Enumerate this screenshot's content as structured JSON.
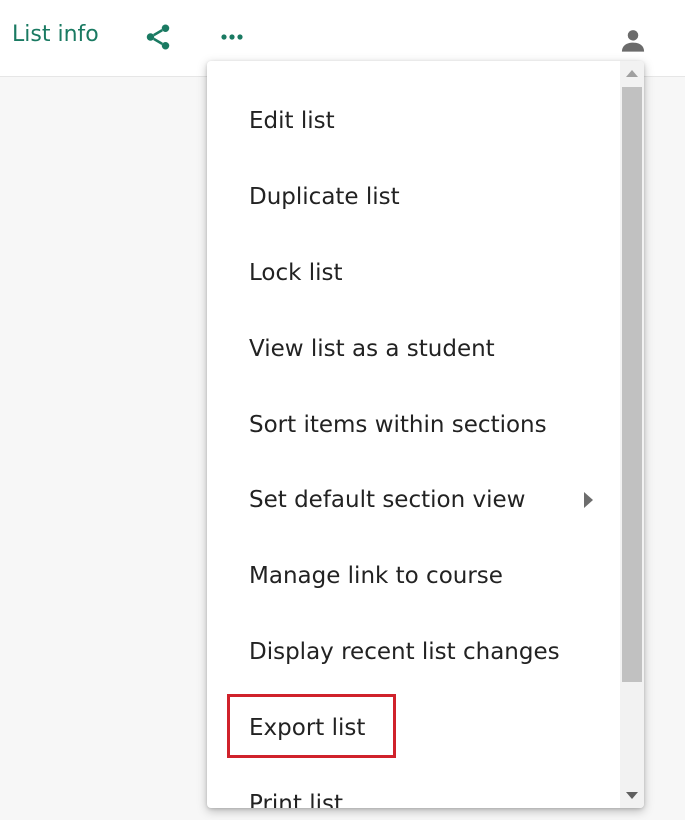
{
  "toolbar": {
    "list_info_label": "List info",
    "share_icon": "share-icon",
    "more_icon": "more-horizontal-icon",
    "user_icon": "user-icon",
    "accent_color": "#1a7a62"
  },
  "menu": {
    "items": [
      {
        "label": "Edit list"
      },
      {
        "label": "Duplicate list"
      },
      {
        "label": "Lock list"
      },
      {
        "label": "View list as a student"
      },
      {
        "label": "Sort items within sections"
      },
      {
        "label": "Set default section view",
        "has_submenu": true
      },
      {
        "label": "Manage link to course"
      },
      {
        "label": "Display recent list changes"
      },
      {
        "label": "Export list",
        "highlighted": true
      },
      {
        "label": "Print list"
      }
    ],
    "highlight_color": "#d0222b"
  }
}
